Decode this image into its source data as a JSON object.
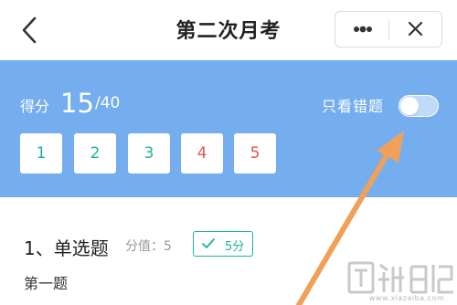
{
  "header": {
    "title": "第二次月考",
    "back_icon": "chevron-left-icon",
    "more_icon": "more-dots-icon",
    "close_icon": "close-icon"
  },
  "score": {
    "label": "得分",
    "value": "15",
    "total": "/40"
  },
  "filter": {
    "label": "只看错题",
    "enabled": false
  },
  "questions": [
    {
      "number": "1",
      "status": "correct"
    },
    {
      "number": "2",
      "status": "correct"
    },
    {
      "number": "3",
      "status": "correct"
    },
    {
      "number": "4",
      "status": "wrong"
    },
    {
      "number": "5",
      "status": "wrong"
    }
  ],
  "question_detail": {
    "title": "1、单选题",
    "points_label": "分值：5",
    "badge_text": "5分",
    "badge_icon": "check-icon",
    "stem": "第一题"
  },
  "colors": {
    "panel": "#74aeef",
    "correct": "#1bb39a",
    "wrong": "#e2574c",
    "arrow": "#f1a05a"
  },
  "watermark": {
    "url": "www.xiazaiba.com"
  }
}
